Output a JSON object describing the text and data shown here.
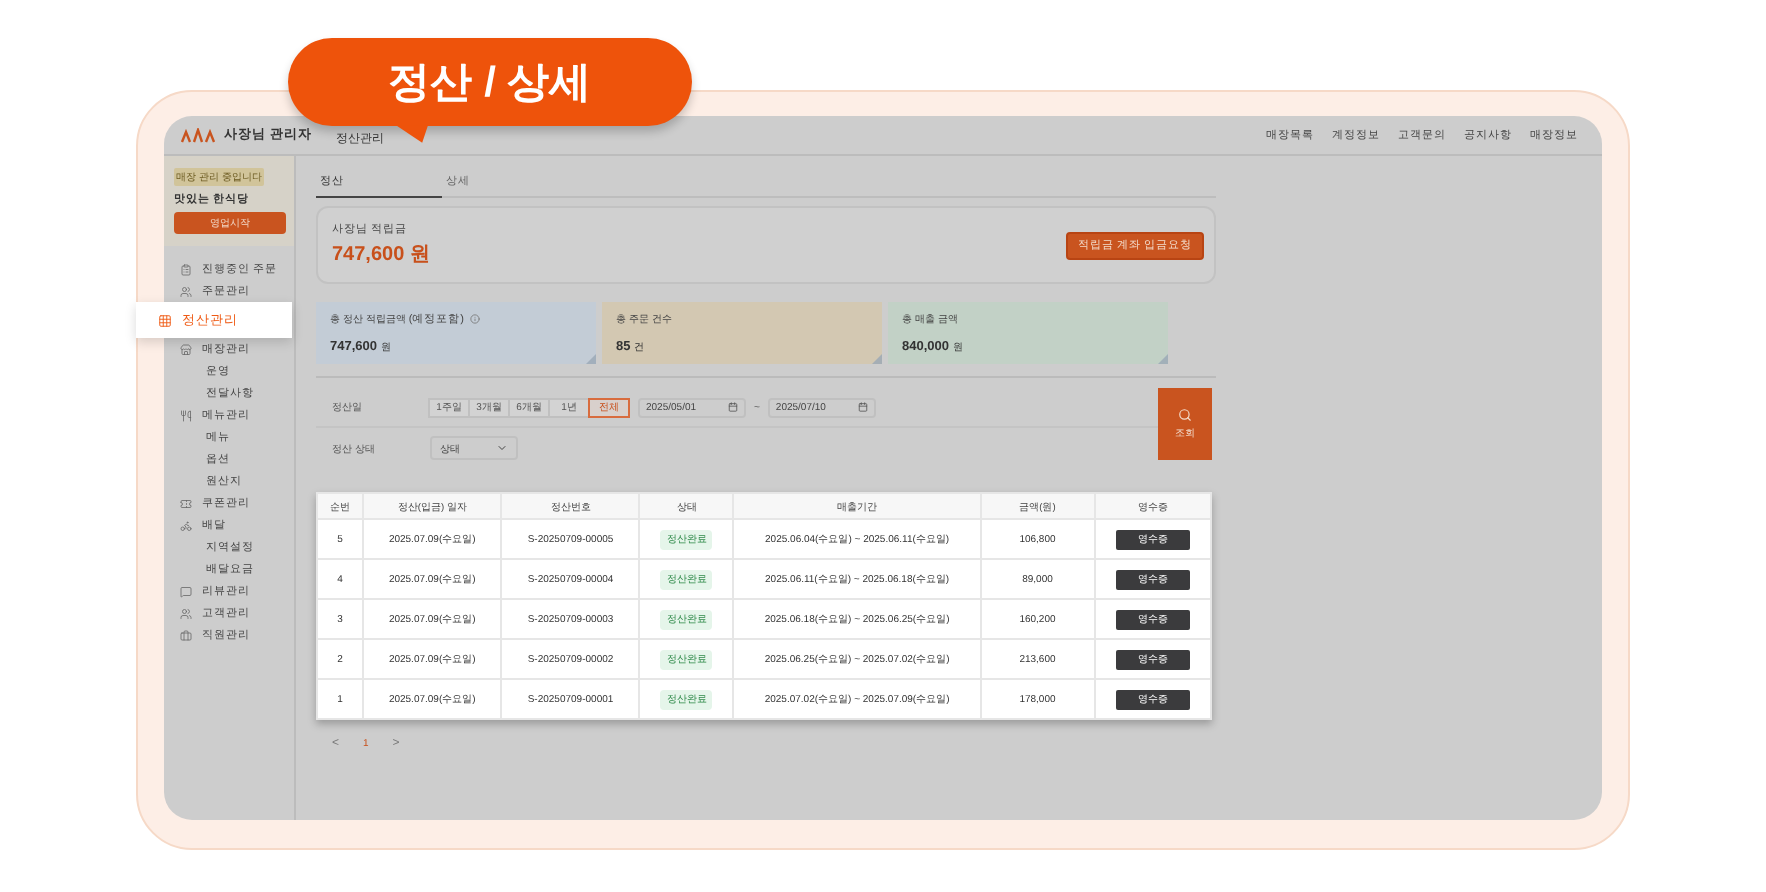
{
  "callout": {
    "text": "정산 / 상세"
  },
  "header": {
    "app_title": "사장님 관리자",
    "page_title": "정산관리",
    "menu": [
      "매장목록",
      "계정정보",
      "고객문의",
      "공지사항",
      "매장정보"
    ]
  },
  "store": {
    "badge": "매장 관리 중입니다",
    "name": "맛있는 한식당",
    "button": "영업시작"
  },
  "sidebar": {
    "items": [
      {
        "label": "진행중인 주문",
        "selected": false
      },
      {
        "label": "주문관리",
        "selected": false
      },
      {
        "label": "정산관리",
        "selected": true
      },
      {
        "label": "매장관리",
        "selected": false,
        "children": [
          {
            "label": "운영"
          },
          {
            "label": "전달사항"
          }
        ]
      },
      {
        "label": "메뉴관리",
        "selected": false,
        "children": [
          {
            "label": "메뉴"
          },
          {
            "label": "옵션"
          },
          {
            "label": "원산지"
          }
        ]
      },
      {
        "label": "쿠폰관리",
        "selected": false
      },
      {
        "label": "배달",
        "selected": false,
        "children": [
          {
            "label": "지역설정"
          },
          {
            "label": "배달요금"
          }
        ]
      },
      {
        "label": "리뷰관리",
        "selected": false
      },
      {
        "label": "고객관리",
        "selected": false
      },
      {
        "label": "직원관리",
        "selected": false
      }
    ]
  },
  "tabs": [
    {
      "label": "정산",
      "selected": true
    },
    {
      "label": "상세",
      "selected": false
    }
  ],
  "balance": {
    "label": "사장님 적립금",
    "amount": "747,600 원",
    "button": "적립금 계좌 입금요청"
  },
  "stats": [
    {
      "label": "총 정산 적립금액",
      "note": "(예정포함)",
      "value": "747,600",
      "unit": "원",
      "color": "#c3ccd6"
    },
    {
      "label": "총 주문 건수",
      "value": "85",
      "unit": "건",
      "color": "#d3c8b2"
    },
    {
      "label": "총 매출 금액",
      "value": "840,000",
      "unit": "원",
      "color": "#c2d1c6"
    }
  ],
  "filter": {
    "date_label": "정산일",
    "periods": [
      {
        "label": "1주일",
        "selected": false
      },
      {
        "label": "3개월",
        "selected": false
      },
      {
        "label": "6개월",
        "selected": false
      },
      {
        "label": "1년",
        "selected": false
      },
      {
        "label": "전체",
        "selected": true
      }
    ],
    "date_from": "2025/05/01",
    "separator": "~",
    "date_to": "2025/07/10",
    "status_label": "정산 상태",
    "status_value": "상태",
    "search_button": "조회"
  },
  "table": {
    "columns": [
      "순번",
      "정산(입금) 일자",
      "정산번호",
      "상태",
      "매출기간",
      "금액(원)",
      "영수증"
    ],
    "rows": [
      {
        "no": "5",
        "date": "2025.07.09(수요일)",
        "id": "S-20250709-00005",
        "status": "정산완료",
        "period": "2025.06.04(수요일) ~ 2025.06.11(수요일)",
        "amount": "106,800",
        "receipt": "영수증"
      },
      {
        "no": "4",
        "date": "2025.07.09(수요일)",
        "id": "S-20250709-00004",
        "status": "정산완료",
        "period": "2025.06.11(수요일) ~ 2025.06.18(수요일)",
        "amount": "89,000",
        "receipt": "영수증"
      },
      {
        "no": "3",
        "date": "2025.07.09(수요일)",
        "id": "S-20250709-00003",
        "status": "정산완료",
        "period": "2025.06.18(수요일) ~ 2025.06.25(수요일)",
        "amount": "160,200",
        "receipt": "영수증"
      },
      {
        "no": "2",
        "date": "2025.07.09(수요일)",
        "id": "S-20250709-00002",
        "status": "정산완료",
        "period": "2025.06.25(수요일) ~ 2025.07.02(수요일)",
        "amount": "213,600",
        "receipt": "영수증"
      },
      {
        "no": "1",
        "date": "2025.07.09(수요일)",
        "id": "S-20250709-00001",
        "status": "정산완료",
        "period": "2025.07.02(수요일) ~ 2025.07.09(수요일)",
        "amount": "178,000",
        "receipt": "영수증"
      }
    ]
  },
  "pagination": {
    "prev": "<",
    "pages": [
      {
        "label": "1",
        "selected": true
      }
    ],
    "next": ">"
  }
}
